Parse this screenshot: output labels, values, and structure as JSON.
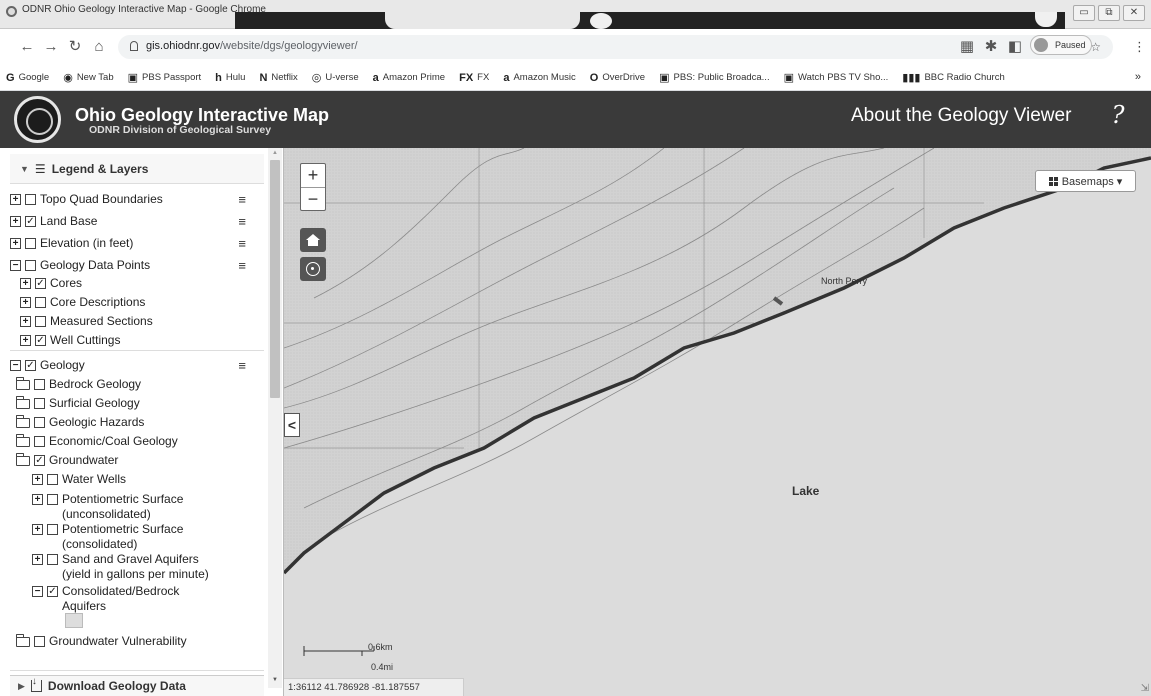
{
  "browser": {
    "window_title": "ODNR Ohio Geology Interactive Map - Google Chrome",
    "url_host": "gis.ohiodnr.gov",
    "url_path": "/website/dgs/geologyviewer/",
    "profile_status": "Paused",
    "bookmarks": [
      {
        "label": "Google",
        "icon": "G"
      },
      {
        "label": "New Tab",
        "icon": "◉"
      },
      {
        "label": "PBS Passport",
        "icon": "▣"
      },
      {
        "label": "Hulu",
        "icon": "h"
      },
      {
        "label": "Netflix",
        "icon": "N"
      },
      {
        "label": "U-verse",
        "icon": "◎"
      },
      {
        "label": "Amazon Prime",
        "icon": "a"
      },
      {
        "label": "FX",
        "icon": "FX"
      },
      {
        "label": "Amazon Music",
        "icon": "a"
      },
      {
        "label": "OverDrive",
        "icon": "O"
      },
      {
        "label": "PBS: Public Broadca...",
        "icon": "▣"
      },
      {
        "label": "Watch PBS TV Sho...",
        "icon": "▣"
      },
      {
        "label": "BBC Radio Church",
        "icon": "▮▮▮"
      }
    ],
    "bookmarks_more": "»"
  },
  "header": {
    "title": "Ohio Geology Interactive Map",
    "subtitle": "ODNR Division of Geological Survey",
    "about_link": "About the Geology Viewer",
    "help_glyph": "?"
  },
  "sidebar": {
    "panel_title": "Legend & Layers",
    "layers": [
      {
        "label": "Topo Quad Boundaries",
        "toggle": "+",
        "checked": false,
        "menu": true
      },
      {
        "label": "Land Base",
        "toggle": "+",
        "checked": true,
        "menu": true
      },
      {
        "label": "Elevation (in feet)",
        "toggle": "+",
        "checked": false,
        "menu": true
      },
      {
        "label": "Geology Data Points",
        "toggle": "−",
        "checked": false,
        "menu": true
      },
      {
        "label": "Cores",
        "toggle": "+",
        "checked": true
      },
      {
        "label": "Core Descriptions",
        "toggle": "+",
        "checked": false
      },
      {
        "label": "Measured Sections",
        "toggle": "+",
        "checked": false
      },
      {
        "label": "Well Cuttings",
        "toggle": "+",
        "checked": true
      },
      {
        "label": "Geology",
        "toggle": "−",
        "checked": true,
        "menu": true
      },
      {
        "label": "Bedrock Geology",
        "checked": false
      },
      {
        "label": "Surficial Geology",
        "checked": false
      },
      {
        "label": "Geologic Hazards",
        "checked": false
      },
      {
        "label": "Economic/Coal Geology",
        "checked": false
      },
      {
        "label": "Groundwater",
        "checked": true
      },
      {
        "label": "Water Wells",
        "toggle": "+",
        "checked": false
      },
      {
        "label": "Potentiometric Surface (unconsolidated)",
        "toggle": "+",
        "checked": false
      },
      {
        "label": "Potentiometric Surface (consolidated)",
        "toggle": "+",
        "checked": false
      },
      {
        "label": "Sand and Gravel Aquifers (yield in gallons per minute)",
        "toggle": "+",
        "checked": false
      },
      {
        "label": "Consolidated/Bedrock Aquifers",
        "toggle": "−",
        "checked": true
      },
      {
        "label": "Groundwater Vulnerability",
        "checked": false
      }
    ],
    "download_label": "Download Geology Data"
  },
  "map": {
    "zoom_in": "+",
    "zoom_out": "−",
    "collapse_glyph": "<",
    "basemaps_label": "Basemaps ▾",
    "place_labels": {
      "north_perry": "North Perry",
      "lake": "Lake"
    },
    "scale_km": "0.6km",
    "scale_mi": "0.4mi",
    "coordinates": "1:36112  41.786928  -81.187557"
  },
  "icons": {
    "seal": "ohio-dnr-seal-icon",
    "home": "home-icon",
    "locate": "locate-icon",
    "help": "help-icon"
  }
}
